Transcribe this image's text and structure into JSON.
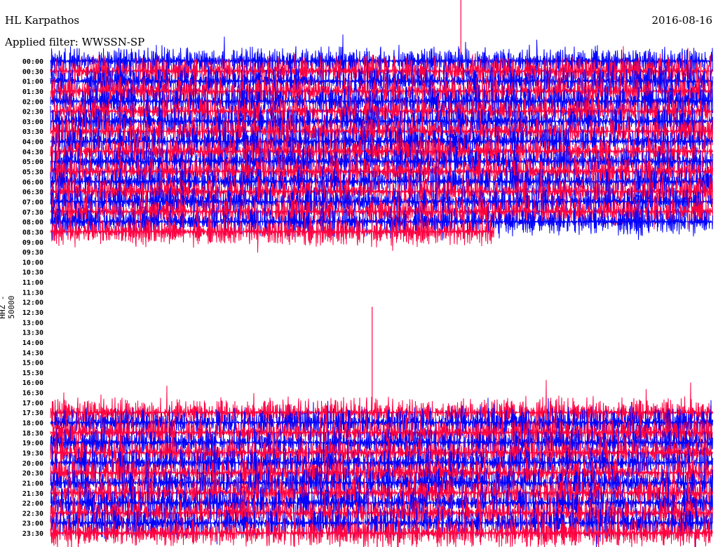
{
  "header": {
    "station": "HL Karpathos",
    "date": "2016-08-16",
    "filter": "Applied filter: WWSSN-SP"
  },
  "chart_data": {
    "type": "line",
    "title": "HL Karpathos",
    "ylabel": "HHZ - 50000",
    "xlabel": "",
    "row_labels": [
      "00:00",
      "00:30",
      "01:00",
      "01:30",
      "02:00",
      "02:30",
      "03:00",
      "03:30",
      "04:00",
      "04:30",
      "05:00",
      "05:30",
      "06:00",
      "06:30",
      "07:00",
      "07:30",
      "08:00",
      "08:30",
      "09:00",
      "09:30",
      "10:00",
      "10:30",
      "11:00",
      "11:30",
      "12:00",
      "12:30",
      "13:00",
      "13:30",
      "14:00",
      "14:30",
      "15:00",
      "15:30",
      "16:00",
      "16:30",
      "17:00",
      "17:30",
      "18:00",
      "18:30",
      "19:00",
      "19:30",
      "20:00",
      "20:30",
      "21:00",
      "21:30",
      "22:00",
      "22:30",
      "23:00",
      "23:30"
    ],
    "row_fill_fraction": [
      1,
      1,
      1,
      1,
      1,
      1,
      1,
      1,
      1,
      1,
      1,
      1,
      1,
      1,
      1,
      1,
      1,
      0.67,
      0,
      0,
      0,
      0,
      0,
      0,
      0,
      0,
      0,
      0,
      0,
      0,
      0,
      0,
      0,
      0,
      0,
      1,
      1,
      1,
      1,
      1,
      1,
      1,
      1,
      1,
      1,
      1,
      1,
      1
    ],
    "series_colors": [
      "#0000ff",
      "#ff0040"
    ],
    "events": [
      {
        "row": "00:00",
        "minute_fraction": 0.62,
        "peak": "large"
      },
      {
        "row": "18:00",
        "minute_fraction": 0.486,
        "peak": "large"
      }
    ]
  }
}
